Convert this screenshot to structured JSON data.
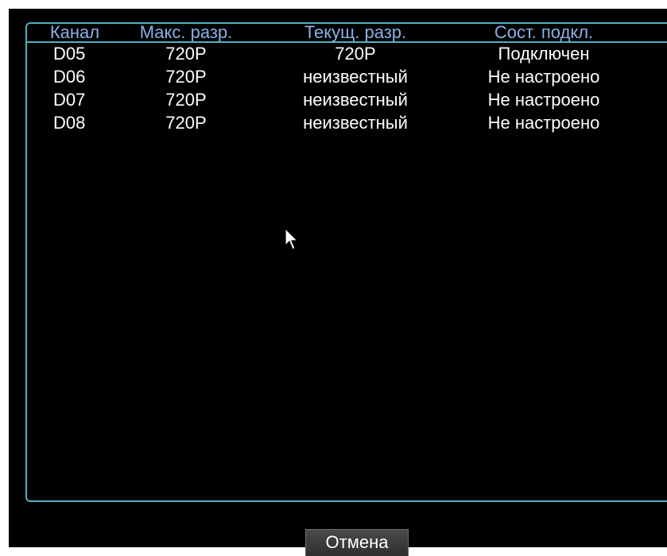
{
  "table": {
    "headers": {
      "channel": "Канал",
      "max_res": "Макс. разр.",
      "cur_res": "Текущ. разр.",
      "status": "Сост. подкл."
    },
    "rows": [
      {
        "channel": "D05",
        "max_res": "720P",
        "cur_res": "720P",
        "status": "Подключен"
      },
      {
        "channel": "D06",
        "max_res": "720P",
        "cur_res": "неизвестный",
        "status": "Не настроено"
      },
      {
        "channel": "D07",
        "max_res": "720P",
        "cur_res": "неизвестный",
        "status": "Не настроено"
      },
      {
        "channel": "D08",
        "max_res": "720P",
        "cur_res": "неизвестный",
        "status": "Не настроено"
      }
    ]
  },
  "footer": {
    "cancel_label": "Отмена"
  },
  "colors": {
    "background": "#000000",
    "border": "#4fb3c0",
    "header_text": "#8ab0e6",
    "text": "#ffffff"
  },
  "icons": {
    "cursor": "mouse-pointer-icon"
  }
}
